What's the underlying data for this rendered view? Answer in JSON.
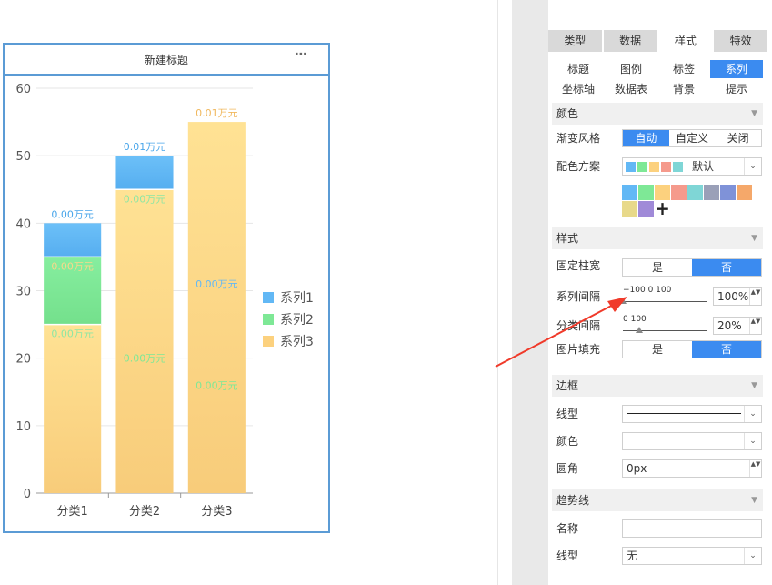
{
  "chart": {
    "title": "新建标题",
    "more_icon": "⋯",
    "legend": [
      "系列1",
      "系列2",
      "系列3"
    ]
  },
  "chart_data": {
    "type": "bar",
    "stacked": true,
    "categories": [
      "分类1",
      "分类2",
      "分类3"
    ],
    "series": [
      {
        "name": "系列1",
        "color": "#62b8f5",
        "values": [
          5,
          5,
          0
        ],
        "labels": [
          "0.00万元",
          "0.01万元",
          ""
        ]
      },
      {
        "name": "系列2",
        "color": "#7ee896",
        "values": [
          10,
          0,
          0
        ],
        "labels": [
          "0.00万元",
          "",
          ""
        ]
      },
      {
        "name": "系列3",
        "color": "#fcd17e",
        "values": [
          25,
          45,
          55
        ],
        "labels": [
          "0.00万元",
          "0.00万元",
          "0.01万元"
        ]
      }
    ],
    "extra_labels": [
      {
        "category": 1,
        "value": 20,
        "text": "0.00万元",
        "color": "#7ee896"
      },
      {
        "category": 2,
        "value": 31,
        "text": "0.00万元",
        "color": "#62b8f5"
      },
      {
        "category": 2,
        "value": 16,
        "text": "0.00万元",
        "color": "#7ee896"
      }
    ],
    "ylim": [
      0,
      60
    ],
    "yticks": [
      0,
      10,
      20,
      30,
      40,
      50,
      60
    ],
    "grid": true,
    "legend_position": "right"
  },
  "panel": {
    "tabs": [
      "类型",
      "数据",
      "样式",
      "特效"
    ],
    "active_tab": "样式",
    "subtabs_row1": [
      "标题",
      "图例",
      "标签",
      "系列"
    ],
    "subtabs_row2": [
      "坐标轴",
      "数据表",
      "背景",
      "提示"
    ],
    "active_subtab": "系列",
    "section_color": "颜色",
    "gradient_label": "渐变风格",
    "gradient_options": [
      "自动",
      "自定义",
      "关闭"
    ],
    "gradient_selected": "自动",
    "scheme_label": "配色方案",
    "scheme_value": "默认",
    "scheme_colors": [
      "#62b8f5",
      "#7ee896",
      "#fcd17e",
      "#f59a8c",
      "#7fd6d6",
      "#9aa0b8",
      "#7f92d8",
      "#f5a86a",
      "#e8d98a",
      "#a08ad8"
    ],
    "plus": "+",
    "section_style": "样式",
    "fixed_width_label": "固定柱宽",
    "yes": "是",
    "no": "否",
    "series_gap_label": "系列间隔",
    "series_gap_ticks": "−100    0    100",
    "series_gap_value": "100%",
    "series_gap_level": 1.0,
    "cat_gap_label": "分类间隔",
    "cat_gap_ticks": "0                   100",
    "cat_gap_value": "20%",
    "cat_gap_level": 0.2,
    "image_fill_label": "图片填充",
    "section_border": "边框",
    "line_type_label": "线型",
    "color_label": "颜色",
    "radius_label": "圆角",
    "radius_value": "0px",
    "section_trend": "趋势线",
    "name_label": "名称",
    "trend_line_type_label": "线型",
    "trend_line_type_value": "无",
    "caret_icon": "▼",
    "chevron_icon": "⌄",
    "spin_icon": "▲▼"
  }
}
